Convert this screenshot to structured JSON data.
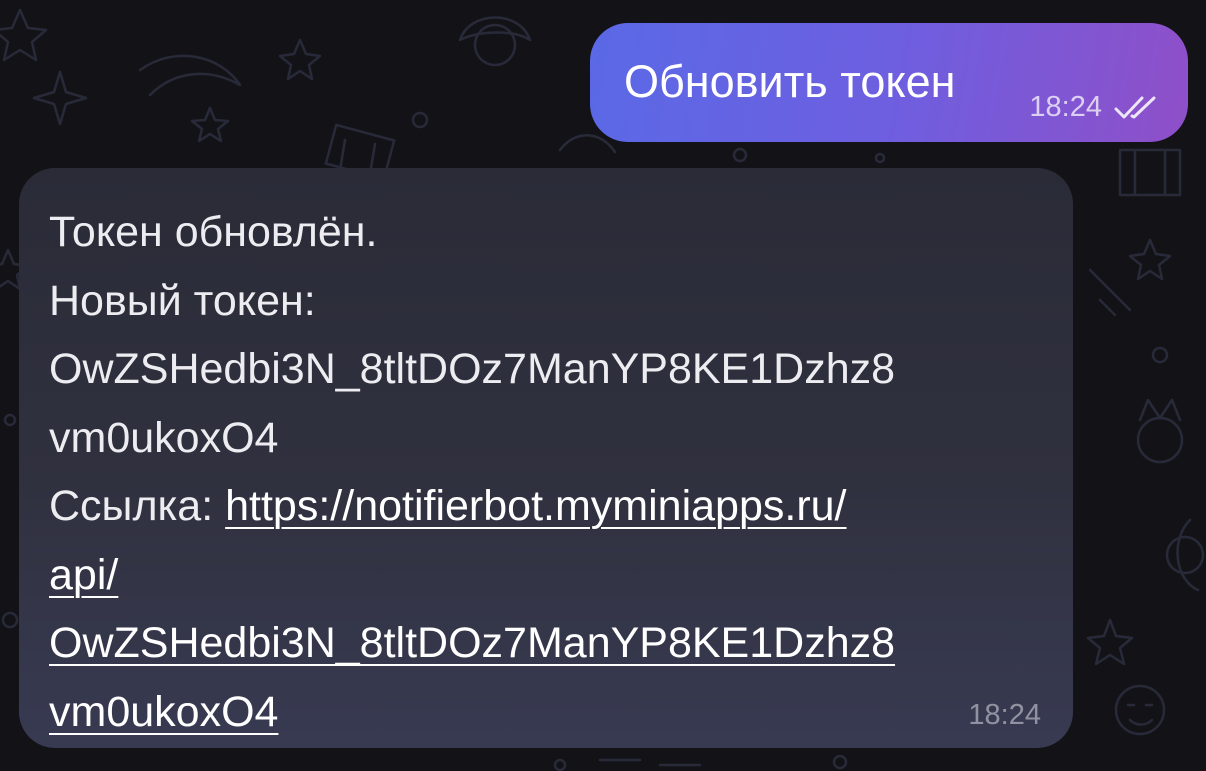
{
  "outgoing_message": {
    "text": "Обновить токен",
    "time": "18:24",
    "status_icon": "double-check-icon",
    "gradient": [
      "#5a69e6",
      "#8f4fc8"
    ]
  },
  "incoming_message": {
    "line1": "Токен обновлён.",
    "line2": "Новый токен:",
    "token_line1": "OwZSHedbi3N_8tltDOz7ManYP8KE1Dzhz8",
    "token_line2": "vm0ukoxO4",
    "link_prefix": "Ссылка: ",
    "link_line1": "https://notifierbot.myminiapps.ru/",
    "link_line2": "api/",
    "link_line3": "OwZSHedbi3N_8tltDOz7ManYP8KE1Dzhz8",
    "link_line4": "vm0ukoxO4",
    "time": "18:24",
    "background": "#30313f"
  },
  "theme": {
    "chat_background": "#131317",
    "doodle_color": "#2b2d3d"
  }
}
